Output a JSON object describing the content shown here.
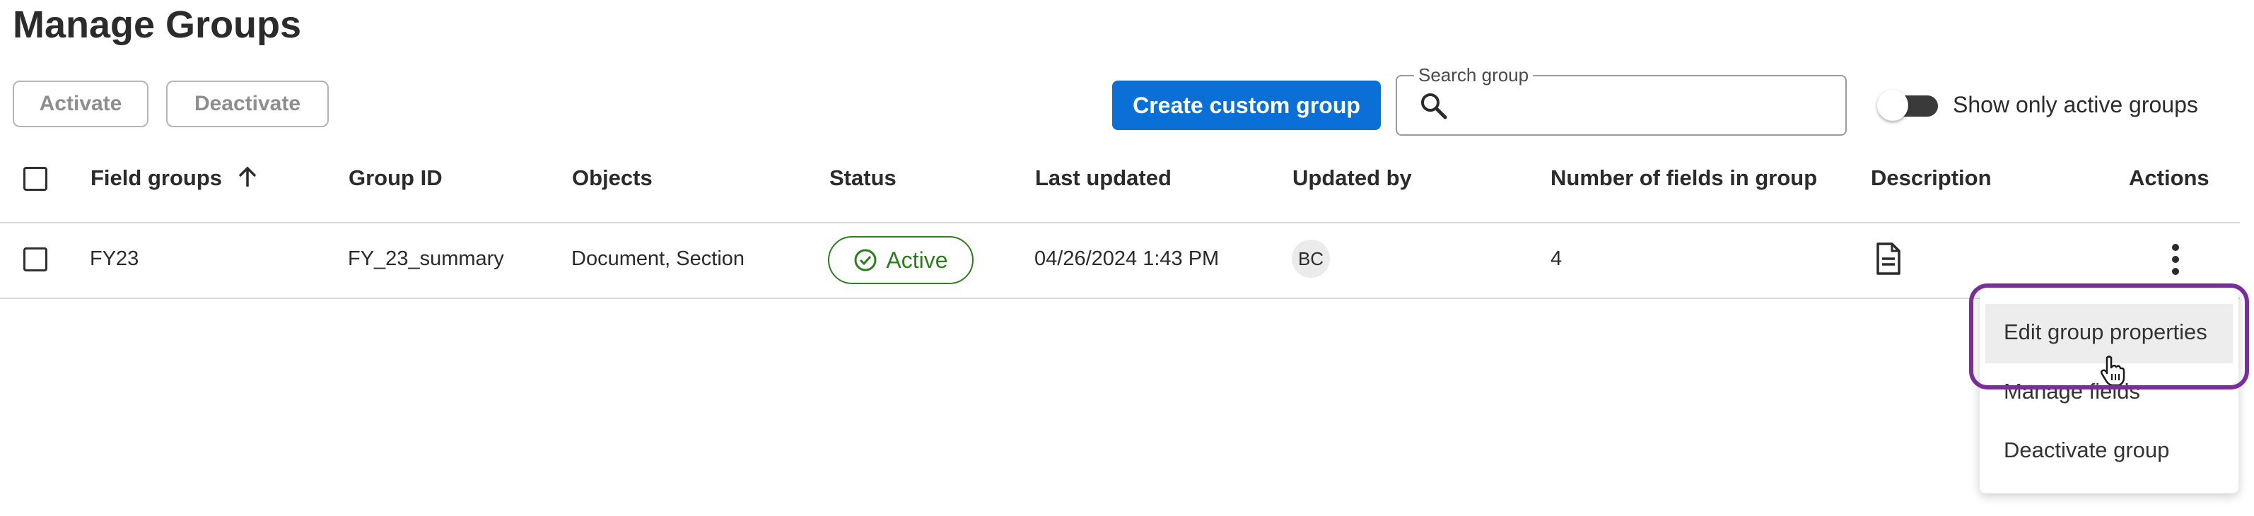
{
  "page": {
    "title": "Manage Groups"
  },
  "toolbar": {
    "activate_label": "Activate",
    "deactivate_label": "Deactivate",
    "create_label": "Create custom group",
    "search_label": "Search group",
    "search_value": "",
    "toggle_label": "Show only active groups",
    "toggle_on": false
  },
  "table": {
    "columns": [
      "Field groups",
      "Group ID",
      "Objects",
      "Status",
      "Last updated",
      "Updated by",
      "Number of fields in group",
      "Description",
      "Actions"
    ],
    "sort": {
      "column": "Field groups",
      "direction": "ascending"
    },
    "rows": [
      {
        "field_group": "FY23",
        "group_id": "FY_23_summary",
        "objects": "Document, Section",
        "status": "Active",
        "last_updated": "04/26/2024 1:43 PM",
        "updated_by": "BC",
        "num_fields": "4",
        "description_icon": "document-icon",
        "actions_icon": "kebab-menu-icon"
      }
    ]
  },
  "menu": {
    "items": [
      "Edit group properties",
      "Manage fields",
      "Deactivate group"
    ],
    "hovered": "Edit group properties"
  },
  "colors": {
    "primary": "#0a70d8",
    "active_green": "#2e7d1d",
    "highlight_ring": "#7a2e9c"
  }
}
